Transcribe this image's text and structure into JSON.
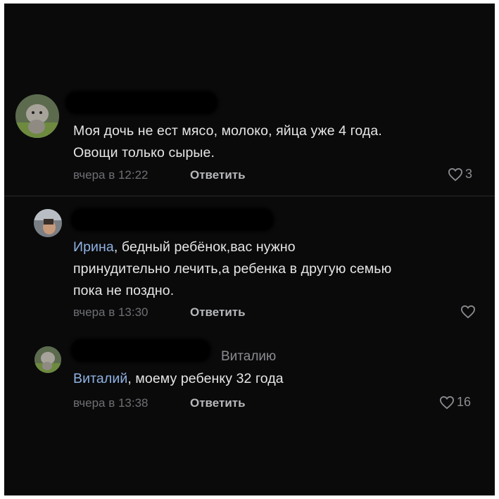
{
  "comments": [
    {
      "lines": [
        "Моя дочь не ест мясо, молоко, яйца уже 4 года.",
        "Овощи только сырые."
      ],
      "time": "вчера в 12:22",
      "reply_label": "Ответить",
      "likes": "3"
    },
    {
      "mention": "Ирина",
      "lines": [
        ", бедный ребёнок,вас нужно",
        "принудительно лечить,а ребенка в другую семью",
        "пока не поздно."
      ],
      "time": "вчера в 13:30",
      "reply_label": "Ответить",
      "likes": ""
    },
    {
      "reply_to": "Виталию",
      "mention": "Виталий",
      "lines": [
        ", моему ребенку 32 года"
      ],
      "time": "вчера в 13:38",
      "reply_label": "Ответить",
      "likes": "16"
    }
  ],
  "colors": {
    "background": "#0a0a0b",
    "text": "#e6e6e6",
    "mention": "#8fb2e2",
    "meta": "#6e6f73"
  }
}
